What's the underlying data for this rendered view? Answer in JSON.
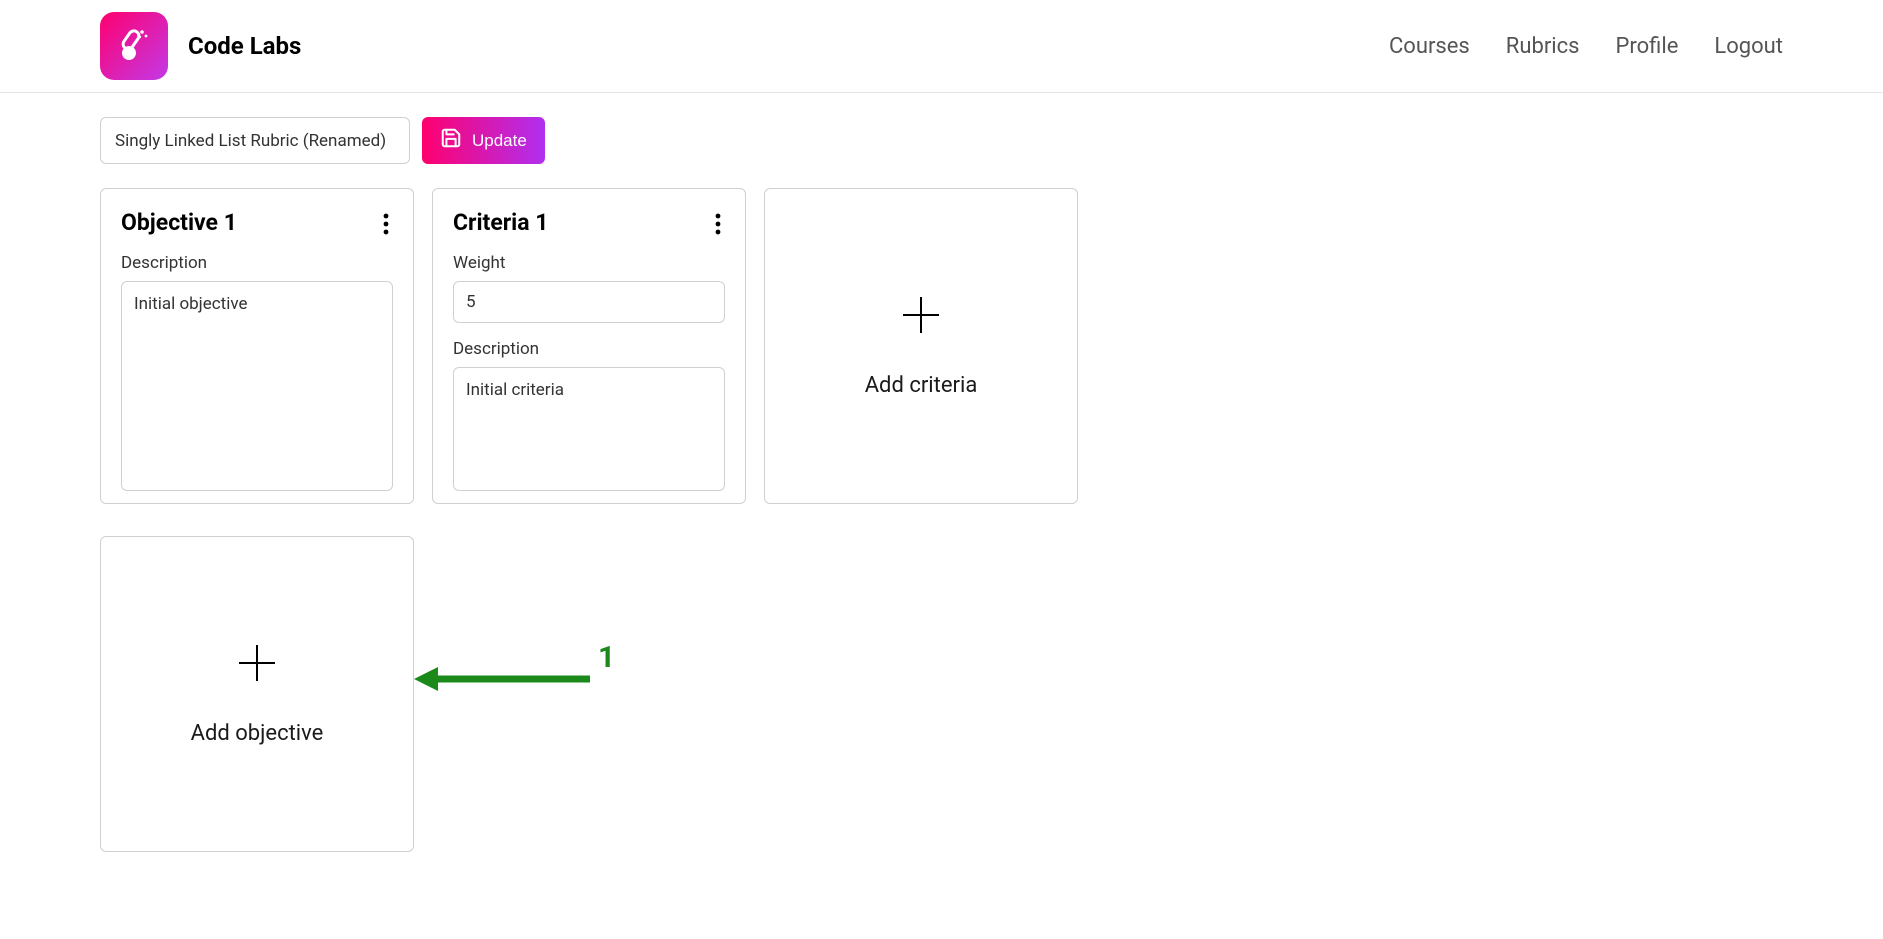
{
  "brand": {
    "name": "Code Labs"
  },
  "nav": {
    "items": [
      {
        "label": "Courses"
      },
      {
        "label": "Rubrics"
      },
      {
        "label": "Profile"
      },
      {
        "label": "Logout"
      }
    ]
  },
  "toolbar": {
    "rubric_name": "Singly Linked List Rubric (Renamed)",
    "update_label": "Update"
  },
  "objective_card": {
    "title": "Objective 1",
    "description_label": "Description",
    "description_value": "Initial objective"
  },
  "criteria_card": {
    "title": "Criteria 1",
    "weight_label": "Weight",
    "weight_value": "5",
    "description_label": "Description",
    "description_value": "Initial criteria"
  },
  "add_criteria": {
    "label": "Add criteria"
  },
  "add_objective": {
    "label": "Add objective"
  },
  "annotation": {
    "number": "1"
  }
}
